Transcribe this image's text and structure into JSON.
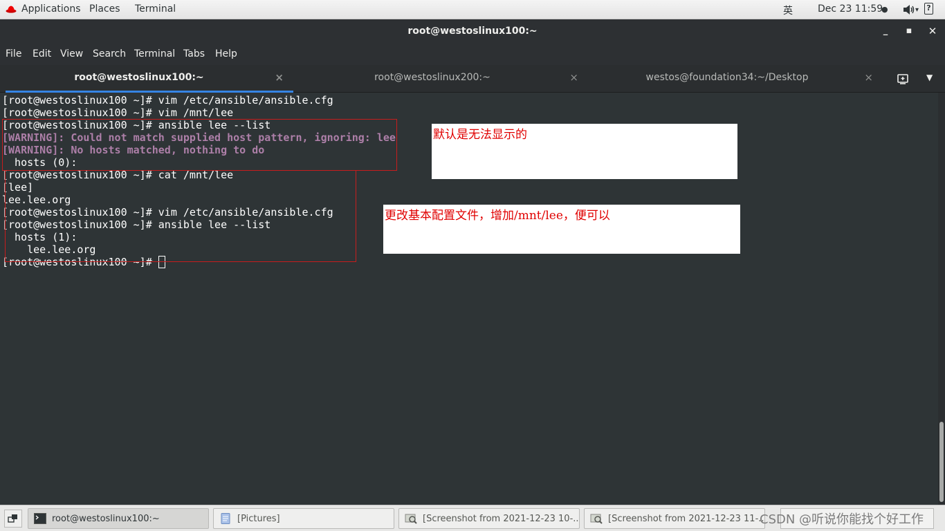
{
  "topbar": {
    "applications": "Applications",
    "places": "Places",
    "terminal": "Terminal",
    "input_method": "英",
    "datetime": "Dec 23  11:59",
    "status_dot": "●",
    "help": "?"
  },
  "window": {
    "title": "root@westoslinux100:~"
  },
  "menubar": {
    "items": [
      "File",
      "Edit",
      "View",
      "Search",
      "Terminal",
      "Tabs",
      "Help"
    ]
  },
  "tabs": [
    {
      "label": "root@westoslinux100:~",
      "active": true
    },
    {
      "label": "root@westoslinux200:~",
      "active": false
    },
    {
      "label": "westos@foundation34:~/Desktop",
      "active": false
    }
  ],
  "tab_close": "×",
  "terminal": {
    "lines": [
      {
        "text": "[root@westoslinux100 ~]# vim /etc/ansible/ansible.cfg"
      },
      {
        "text": "[root@westoslinux100 ~]# vim /mnt/lee"
      },
      {
        "text": "[root@westoslinux100 ~]# ansible lee --list"
      },
      {
        "text": "[WARNING]: Could not match supplied host pattern, ignoring: lee",
        "style": "warn"
      },
      {
        "text": "[WARNING]: No hosts matched, nothing to do",
        "style": "warn"
      },
      {
        "text": "  hosts (0):"
      },
      {
        "text": "[root@westoslinux100 ~]# cat /mnt/lee"
      },
      {
        "text": "[lee]"
      },
      {
        "text": "lee.lee.org"
      },
      {
        "text": "[root@westoslinux100 ~]# vim /etc/ansible/ansible.cfg"
      },
      {
        "text": "[root@westoslinux100 ~]# ansible lee --list"
      },
      {
        "text": "  hosts (1):"
      },
      {
        "text": "    lee.lee.org"
      },
      {
        "text": "[root@westoslinux100 ~]# "
      }
    ]
  },
  "annotations": {
    "note1": "默认是无法显示的",
    "note2": "更改基本配置文件，增加/mnt/lee，便可以"
  },
  "taskbar": {
    "items": [
      {
        "label": "root@westoslinux100:~",
        "icon": "terminal-icon",
        "active": true
      },
      {
        "label": "[Pictures]",
        "icon": "folder-icon",
        "active": false
      },
      {
        "label": "[Screenshot from 2021-12-23 10-...",
        "icon": "image-viewer-icon",
        "active": false
      },
      {
        "label": "[Screenshot from 2021-12-23 11-...",
        "icon": "image-viewer-icon",
        "active": false
      }
    ],
    "watermark": "CSDN @听说你能找个好工作"
  },
  "colors": {
    "accent": "#3584e4",
    "warning": "#ad7fa8",
    "annotation_red": "#e00000"
  }
}
